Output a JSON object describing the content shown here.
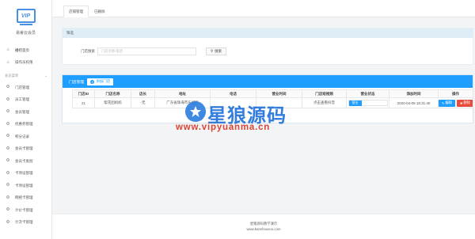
{
  "app": {
    "logo_text": "VIP",
    "name": "易睿云会员"
  },
  "sidebar": {
    "top_items": [
      {
        "icon": "home-icon",
        "label": "播控首页"
      },
      {
        "icon": "home-icon",
        "label": "操作员权限"
      }
    ],
    "section_label": "会员菜单",
    "items": [
      {
        "icon": "gear-icon",
        "label": "门店管理"
      },
      {
        "icon": "gear-icon",
        "label": "员工管理"
      },
      {
        "icon": "gear-icon",
        "label": "会员管理"
      },
      {
        "icon": "gear-icon",
        "label": "优惠券管理"
      },
      {
        "icon": "gear-icon",
        "label": "积分记录"
      },
      {
        "icon": "gear-icon",
        "label": "会员卡管理"
      },
      {
        "icon": "gear-icon",
        "label": "会员卡类别"
      },
      {
        "icon": "gear-icon",
        "label": "卡项设管理"
      },
      {
        "icon": "gear-icon",
        "label": "卡项设管理"
      },
      {
        "icon": "gear-icon",
        "label": "网络卡管理"
      },
      {
        "icon": "gear-icon",
        "label": "计价卡管理"
      },
      {
        "icon": "gear-icon",
        "label": "计次卡管理"
      }
    ]
  },
  "tabs": [
    {
      "label": "店铺管理",
      "active": true
    },
    {
      "label": "已删除",
      "active": false
    }
  ],
  "filter": {
    "header": "筛选",
    "field_label": "门店搜索",
    "placeholder": "门店名称/电话",
    "search_label": "搜索"
  },
  "list": {
    "title": "门店管理",
    "add_label": "添加门店",
    "columns": [
      "门店ID",
      "门店名称",
      "店长",
      "地址",
      "电话",
      "营业时间",
      "门店短视频",
      "营业状态",
      "添加时间",
      "操作"
    ],
    "rows": [
      {
        "id": "21",
        "name": "帮花团妈妈",
        "manager": "-无",
        "address": "广东省珠海市东城区",
        "phone": "",
        "hours": "",
        "video": "点击查看抖音",
        "status": "营业",
        "added": "2020-04-09 18:31:40",
        "edit_label": "编辑",
        "delete_label": "删除"
      }
    ]
  },
  "footer": {
    "line1": "星猿源码教学演示",
    "line2": "www.banshousoo.com"
  },
  "watermark": {
    "title": "星狼源码",
    "url": "www.vipyuanma.cn"
  },
  "colors": {
    "primary": "#1e9fff",
    "danger": "#e74c3c",
    "filter_head": "#dfeef6"
  }
}
